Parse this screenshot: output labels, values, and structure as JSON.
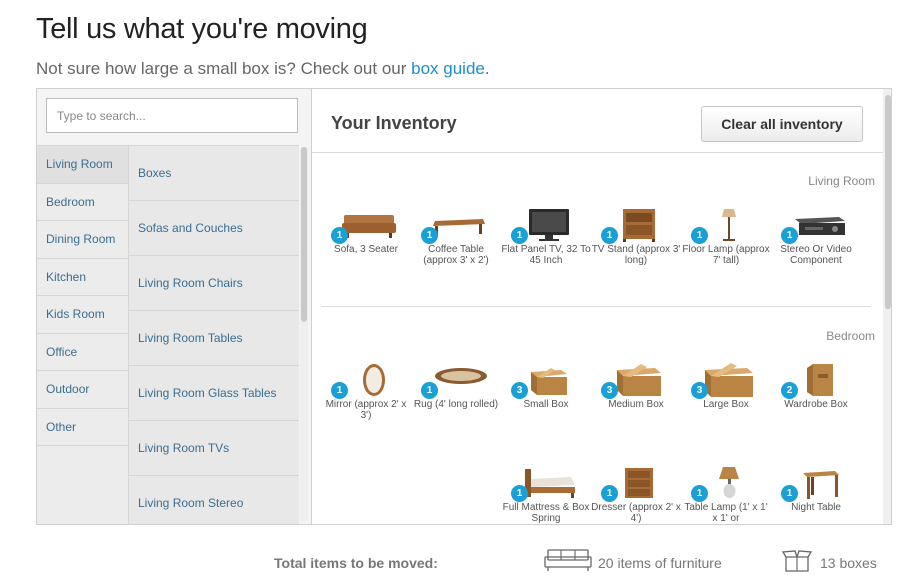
{
  "header": {
    "title": "Tell us what you're moving",
    "subtitle_text": "Not sure how large a small box is? Check out our ",
    "subtitle_link": "box guide",
    "subtitle_end": "."
  },
  "search": {
    "placeholder": "Type to search..."
  },
  "rooms": [
    "Living Room",
    "Bedroom",
    "Dining Room",
    "Kitchen",
    "Kids Room",
    "Office",
    "Outdoor",
    "Other"
  ],
  "categories": [
    "Boxes",
    "Sofas and Couches",
    "Living Room Chairs",
    "Living Room Tables",
    "Living Room Glass Tables",
    "Living Room TVs",
    "Living Room Stereo"
  ],
  "inventory": {
    "title": "Your Inventory",
    "clear_label": "Clear all inventory",
    "sections": [
      {
        "name": "Living Room",
        "items": [
          {
            "count": "1",
            "name": "Sofa, 3 Seater",
            "icon": "sofa-icon"
          },
          {
            "count": "1",
            "name": "Coffee Table (approx 3' x 2')",
            "icon": "coffee-table-icon"
          },
          {
            "count": "1",
            "name": "Flat Panel TV, 32 To 45 Inch",
            "icon": "tv-icon"
          },
          {
            "count": "1",
            "name": "TV Stand (approx 3' long)",
            "icon": "tv-stand-icon"
          },
          {
            "count": "1",
            "name": "Floor Lamp (approx 7' tall)",
            "icon": "floor-lamp-icon"
          },
          {
            "count": "1",
            "name": "Stereo Or Video Component",
            "icon": "stereo-icon"
          }
        ]
      },
      {
        "name": "Bedroom",
        "items": [
          {
            "count": "1",
            "name": "Mirror (approx 2' x 3')",
            "icon": "mirror-icon"
          },
          {
            "count": "1",
            "name": "Rug (4' long rolled)",
            "icon": "rug-icon"
          },
          {
            "count": "3",
            "name": "Small Box",
            "icon": "box-icon"
          },
          {
            "count": "3",
            "name": "Medium Box",
            "icon": "box-icon"
          },
          {
            "count": "3",
            "name": "Large Box",
            "icon": "box-icon"
          },
          {
            "count": "2",
            "name": "Wardrobe Box",
            "icon": "wardrobe-box-icon"
          },
          {
            "count": "1",
            "name": "Full Mattress & Box Spring",
            "icon": "bed-icon"
          },
          {
            "count": "1",
            "name": "Dresser (approx 2' x 4')",
            "icon": "dresser-icon"
          },
          {
            "count": "1",
            "name": "Table Lamp (1' x 1' x 1' or",
            "icon": "table-lamp-icon"
          },
          {
            "count": "1",
            "name": "Night Table",
            "icon": "night-table-icon"
          }
        ]
      }
    ]
  },
  "footer": {
    "total_label": "Total items to be moved:",
    "furniture_text": "20 items of furniture",
    "boxes_text": "13 boxes"
  },
  "colors": {
    "accent": "#1a9fd6",
    "link": "#1a8fc7",
    "wood": "#a86b35"
  }
}
